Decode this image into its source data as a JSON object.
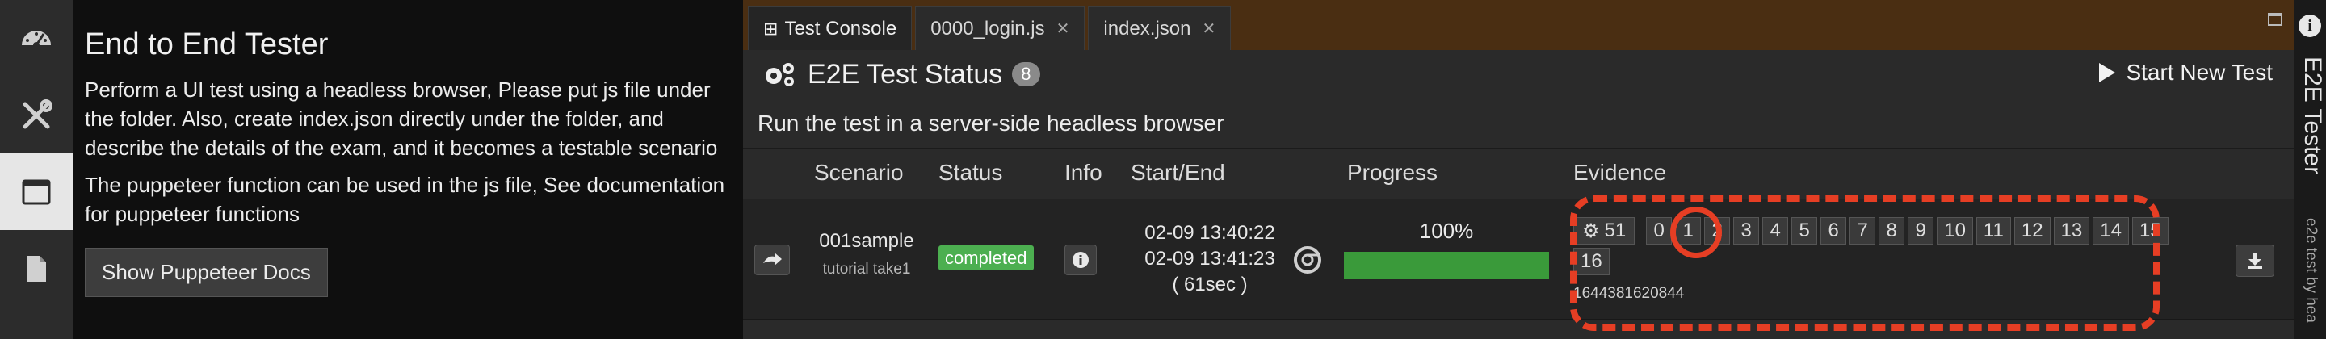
{
  "activity_bar": {
    "items": [
      {
        "name": "dashboard-icon",
        "active": false
      },
      {
        "name": "tools-icon",
        "active": false
      },
      {
        "name": "browser-window-icon",
        "active": true
      },
      {
        "name": "file-icon",
        "active": false
      }
    ]
  },
  "side_panel": {
    "title": "End to End Tester",
    "paragraph1": "Perform a UI test using a headless browser, Please put js file under the folder. Also, create index.json directly under the folder, and describe the details of the exam, and it becomes a testable scenario",
    "paragraph2": "The puppeteer function can be used in the js file, See documentation for puppeteer functions",
    "docs_button": "Show Puppeteer Docs"
  },
  "tabs": [
    {
      "label": "Test Console",
      "icon": "console-icon",
      "active": true,
      "closable": false
    },
    {
      "label": "0000_login.js",
      "active": false,
      "closable": true
    },
    {
      "label": "index.json",
      "active": false,
      "closable": true
    }
  ],
  "header": {
    "title": "E2E Test Status",
    "count": "8",
    "start_button": "Start New Test"
  },
  "description": "Run the test in a server-side headless browser",
  "columns": {
    "scenario": "Scenario",
    "status": "Status",
    "info": "Info",
    "start_end": "Start/End",
    "progress": "Progress",
    "evidence": "Evidence"
  },
  "row": {
    "scenario_name": "001sample",
    "scenario_sub": "tutorial take1",
    "status": "completed",
    "start": "02-09 13:40:22",
    "end": "02-09 13:41:23",
    "duration": "( 61sec )",
    "progress_label": "100%",
    "progress_value": 1.0,
    "evidence_gear_count": "51",
    "evidence_steps": [
      "0",
      "1",
      "2",
      "3",
      "4",
      "5",
      "6",
      "7",
      "8",
      "9",
      "10",
      "11",
      "12",
      "13",
      "14",
      "15",
      "16"
    ],
    "evidence_id": "1644381620844"
  },
  "right_bar": {
    "title": "E2E Tester",
    "subtitle": "e2e test by hea"
  },
  "colors": {
    "accent_highlight": "#e63e24",
    "status_green": "#4caf50",
    "progress_green": "#3a9a3a",
    "tabbar_brown": "#4a2e12"
  }
}
